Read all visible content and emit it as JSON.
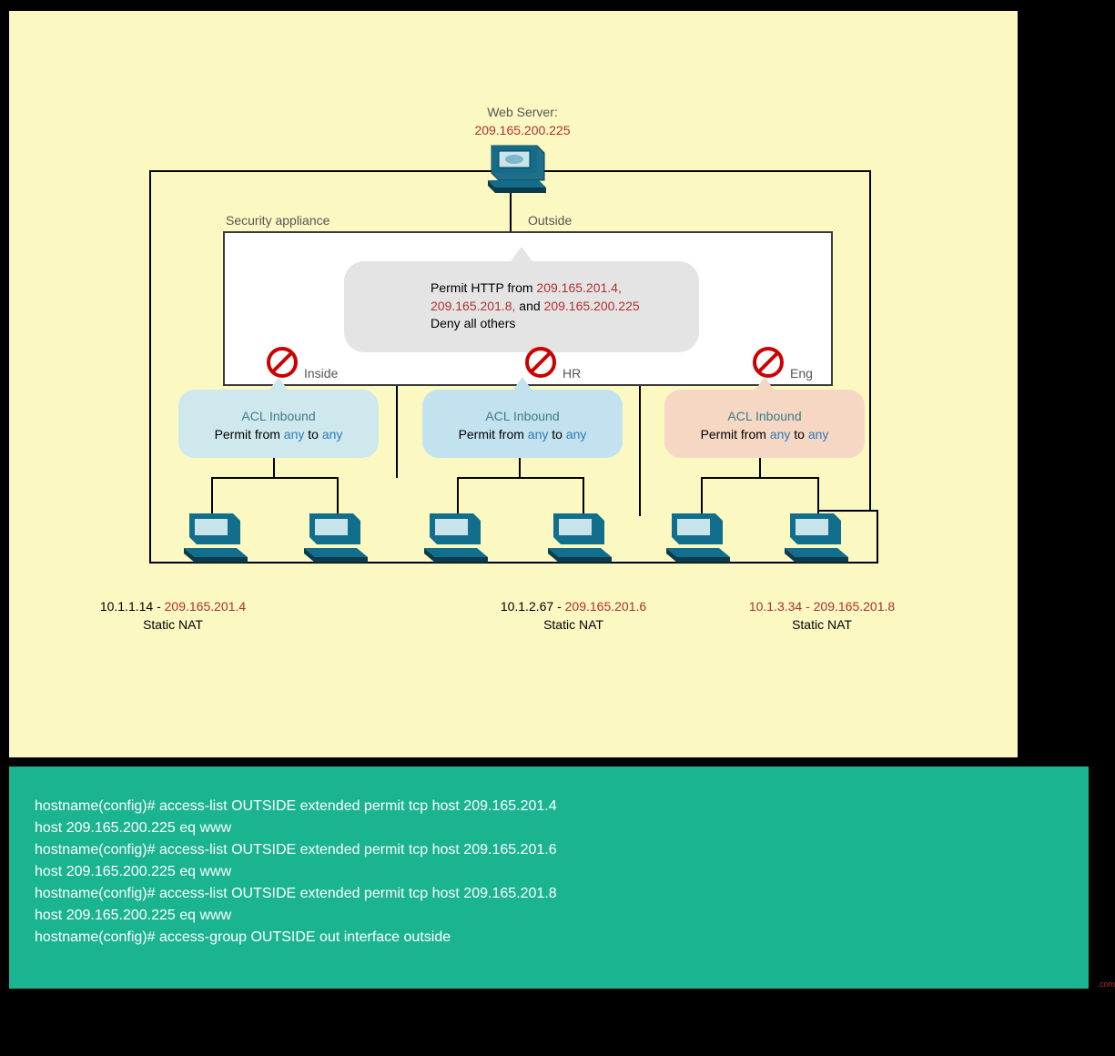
{
  "webserver": {
    "title": "Web Server:",
    "ip": "209.165.200.225"
  },
  "labels": {
    "security_appliance": "Security appliance",
    "outside": "Outside",
    "inside": "Inside",
    "hr": "HR",
    "eng": "Eng"
  },
  "info": {
    "line1a": "Permit HTTP from ",
    "line1b": "209.165.201.4,",
    "line2a": "209.165.201.8,",
    "line2b": " and ",
    "line2c": "209.165.200.225",
    "line3": "Deny all others"
  },
  "acl": {
    "heading": "ACL Inbound",
    "permita": "Permit from ",
    "any": "any",
    "to": " to "
  },
  "nat": {
    "static": "Static NAT",
    "n1a": "10.1.1.14 - ",
    "n1b": "209.165.201.4",
    "n2a": "10.1.2.67 - ",
    "n2b": "209.165.201.6",
    "n3a": "10.1.3.34 - ",
    "n3b": "209.165.201.8"
  },
  "code": {
    "l1": "hostname(config)# access-list OUTSIDE extended permit tcp host 209.165.201.4",
    "l2": "host 209.165.200.225 eq www",
    "l3": "hostname(config)# access-list OUTSIDE extended permit tcp host 209.165.201.6",
    "l4": "host 209.165.200.225 eq www",
    "l5": "hostname(config)# access-list OUTSIDE extended permit tcp host 209.165.201.8",
    "l6": "host 209.165.200.225 eq www",
    "l7": "hostname(config)# access-group OUTSIDE out interface outside"
  },
  "footer": ".com"
}
